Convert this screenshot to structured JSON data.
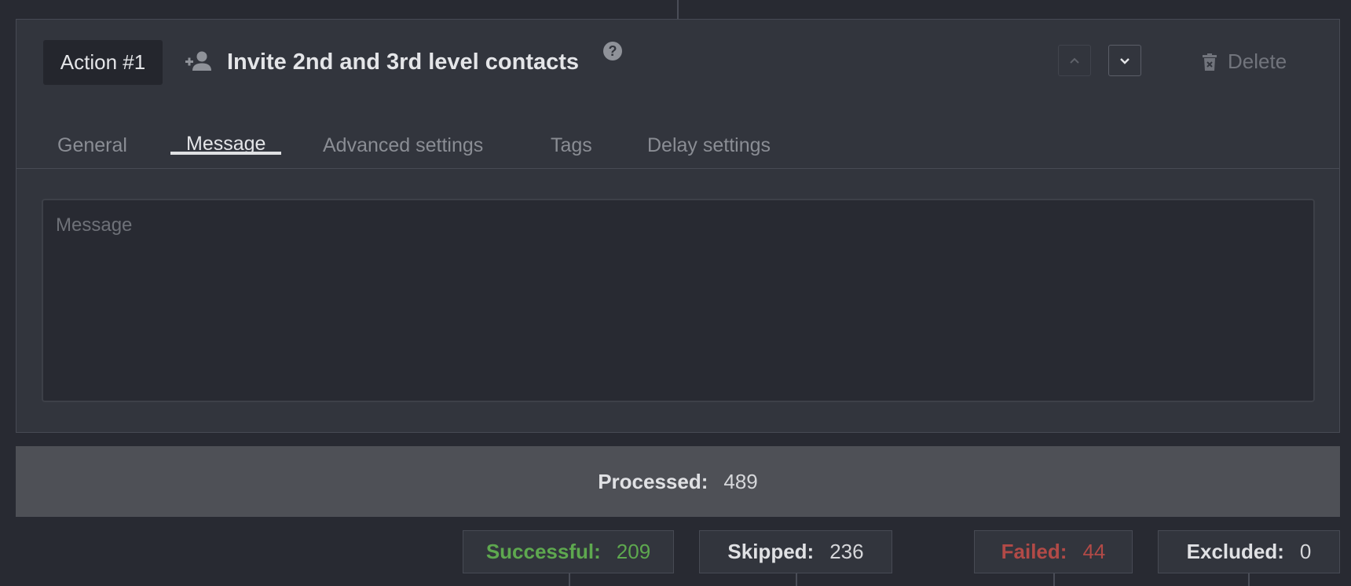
{
  "action": {
    "badge": "Action #1",
    "icon": "person-add-icon",
    "title": "Invite 2nd and 3rd level contacts",
    "help_glyph": "?",
    "move_up_icon": "chevron-up-icon",
    "move_down_icon": "chevron-down-icon",
    "delete_label": "Delete",
    "delete_icon": "trash-icon"
  },
  "tabs": [
    {
      "label": "General",
      "active": false
    },
    {
      "label": "Message",
      "active": true
    },
    {
      "label": "Advanced settings",
      "active": false
    },
    {
      "label": "Tags",
      "active": false
    },
    {
      "label": "Delay settings",
      "active": false
    }
  ],
  "message": {
    "placeholder": "Message",
    "value": ""
  },
  "stats": {
    "processed_label": "Processed:",
    "processed_value": "489",
    "successful_label": "Successful:",
    "successful_value": "209",
    "skipped_label": "Skipped:",
    "skipped_value": "236",
    "failed_label": "Failed:",
    "failed_value": "44",
    "excluded_label": "Excluded:",
    "excluded_value": "0"
  },
  "colors": {
    "background": "#282a32",
    "card": "#32353d",
    "success": "#5ea84f",
    "failed": "#b24a47",
    "processed_bar": "#4e5056"
  }
}
